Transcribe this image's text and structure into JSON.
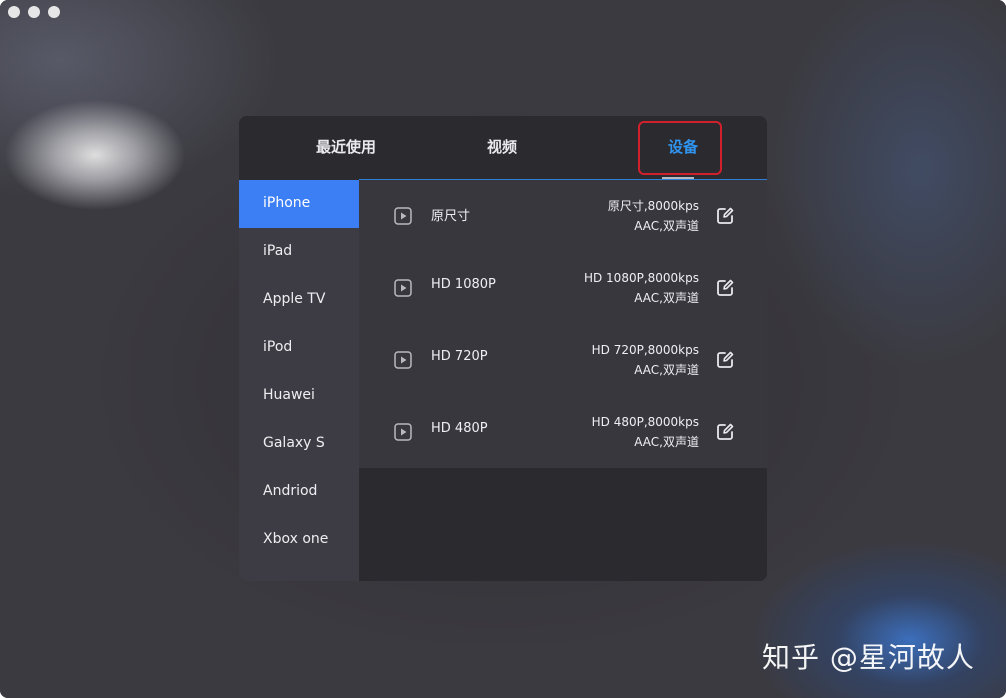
{
  "window": {
    "traffic_lights": [
      "close",
      "minimize",
      "zoom"
    ]
  },
  "tabs": [
    {
      "label": "最近使用"
    },
    {
      "label": "视频"
    },
    {
      "label": "设备",
      "selected": true
    }
  ],
  "sidebar": {
    "items": [
      {
        "label": "iPhone",
        "selected": true
      },
      {
        "label": "iPad"
      },
      {
        "label": "Apple TV"
      },
      {
        "label": "iPod"
      },
      {
        "label": "Huawei"
      },
      {
        "label": "Galaxy S"
      },
      {
        "label": "Andriod"
      },
      {
        "label": "Xbox one"
      }
    ]
  },
  "presets": [
    {
      "name": "原尺寸",
      "spec_line1": "原尺寸,8000kps",
      "spec_line2": "AAC,双声道"
    },
    {
      "name": "HD 1080P",
      "spec_line1": "HD 1080P,8000kps",
      "spec_line2": "AAC,双声道"
    },
    {
      "name": "HD 720P",
      "spec_line1": "HD 720P,8000kps",
      "spec_line2": "AAC,双声道"
    },
    {
      "name": "HD 480P",
      "spec_line1": "HD 480P,8000kps",
      "spec_line2": "AAC,双声道"
    }
  ],
  "icons": {
    "play": "play-icon",
    "edit": "edit-icon"
  },
  "colors": {
    "accent": "#3c7ef4",
    "selected_tab_text": "#2f95f0",
    "highlight_box": "#d0202c"
  },
  "watermark": "知乎 @星河故人"
}
